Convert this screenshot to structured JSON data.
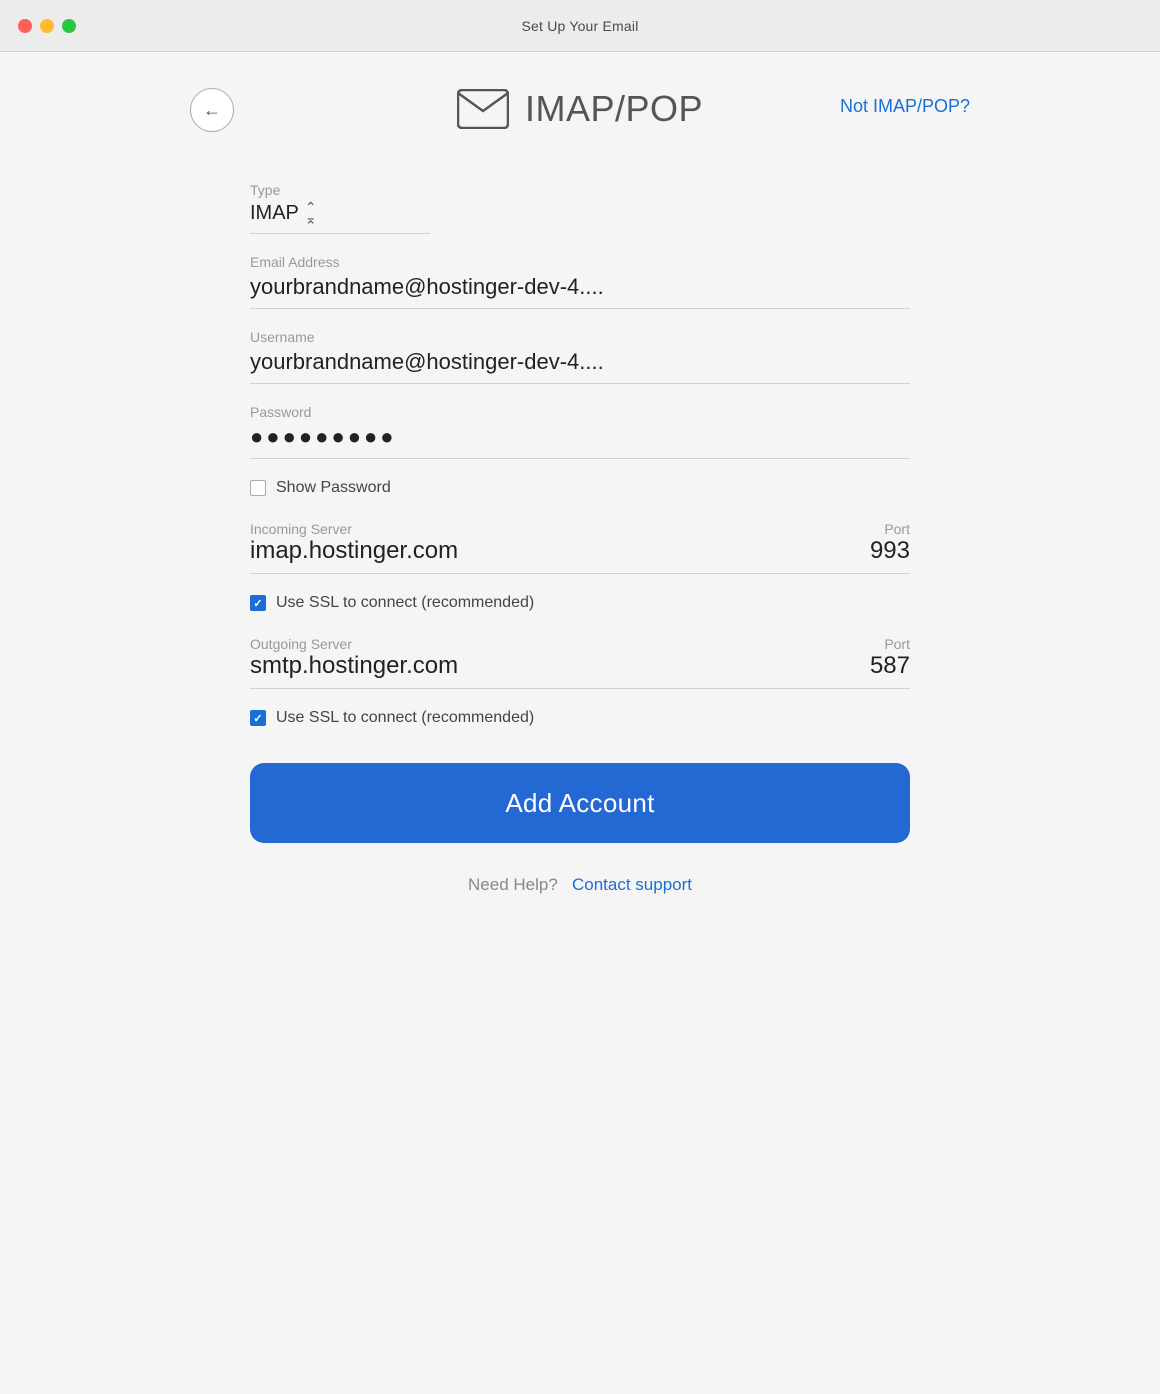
{
  "window": {
    "title": "Set Up Your Email"
  },
  "header": {
    "title": "IMAP/POP",
    "not_imap_label": "Not IMAP/POP?"
  },
  "form": {
    "type_label": "Type",
    "type_value": "IMAP",
    "email_label": "Email Address",
    "email_value": "yourbrandname@hostinger-dev-4....",
    "username_label": "Username",
    "username_value": "yourbrandname@hostinger-dev-4....",
    "password_label": "Password",
    "password_value": "●●●●●●●●●",
    "show_password_label": "Show Password",
    "incoming_server_label": "Incoming Server",
    "incoming_server_value": "imap.hostinger.com",
    "incoming_port_label": "Port",
    "incoming_port_value": "993",
    "use_ssl_incoming_label": "Use SSL to connect (recommended)",
    "outgoing_server_label": "Outgoing Server",
    "outgoing_server_value": "smtp.hostinger.com",
    "outgoing_port_label": "Port",
    "outgoing_port_value": "587",
    "use_ssl_outgoing_label": "Use SSL to connect (recommended)",
    "add_account_label": "Add Account"
  },
  "footer": {
    "help_text": "Need Help?",
    "contact_link": "Contact support"
  },
  "colors": {
    "accent": "#2468d4",
    "link": "#1a6ed8",
    "label": "#999999",
    "value": "#222222",
    "border": "#d0d0d0",
    "checkbox_checked": "#1a6ed8"
  }
}
